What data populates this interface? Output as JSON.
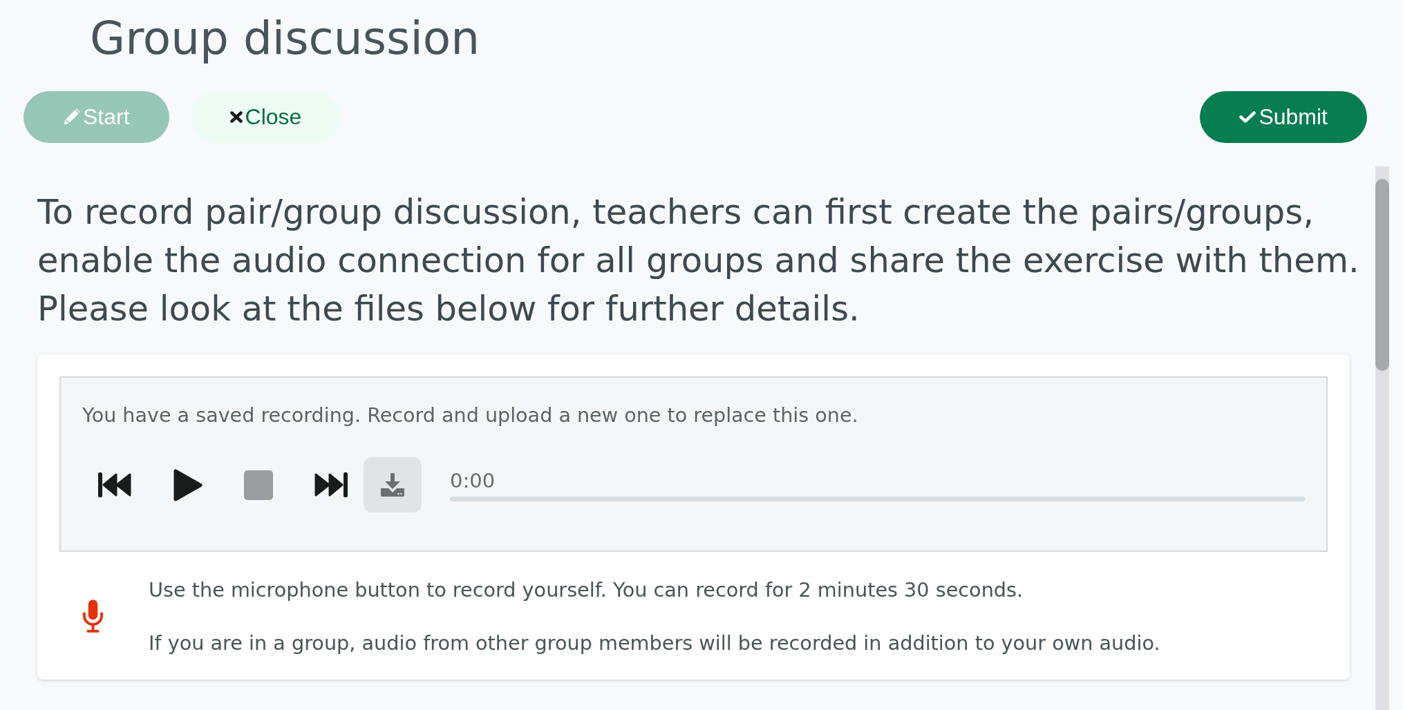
{
  "page": {
    "title": "Group discussion"
  },
  "toolbar": {
    "buttons": [
      {
        "label": "Start",
        "kind": "edit",
        "disabled": true
      },
      {
        "label": "Close",
        "kind": "close",
        "disabled": false
      },
      {
        "label": "Submit",
        "kind": "submit",
        "disabled": false
      }
    ]
  },
  "instructions": "To record pair/group discussion, teachers can first create the pairs/groups, enable the audio connection for all groups and share the exercise with them. Please look at the files below for further details.",
  "recorder": {
    "notice": "You have a saved recording. Record and upload a new one to replace this one.",
    "controls": [
      {
        "kind": "previous",
        "disabled": false
      },
      {
        "kind": "play",
        "disabled": false
      },
      {
        "kind": "stop",
        "disabled": true
      },
      {
        "kind": "next",
        "disabled": false
      },
      {
        "kind": "download",
        "disabled": false
      }
    ],
    "time": "0:00",
    "hints": [
      "Use the microphone button to record yourself. You can record for 2 minutes 30 seconds.",
      "If you are in a group, audio from other group members will be recorded in addition to your own audio."
    ]
  }
}
